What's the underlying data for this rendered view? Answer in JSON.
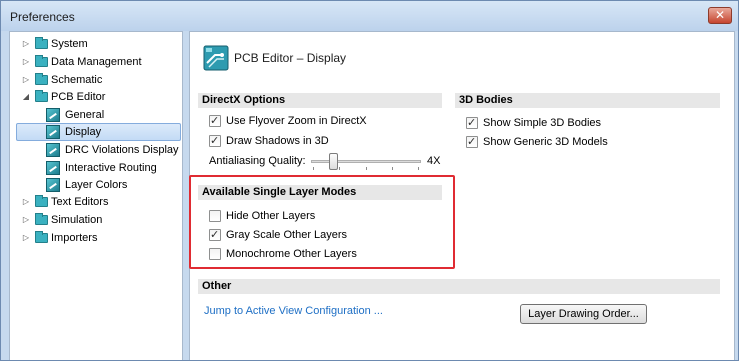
{
  "window": {
    "title": "Preferences",
    "close_symbol": "✕"
  },
  "tree": {
    "items": [
      {
        "label": "System",
        "expander": "▷",
        "icon": "folder-icon"
      },
      {
        "label": "Data Management",
        "expander": "▷",
        "icon": "folder-icon"
      },
      {
        "label": "Schematic",
        "expander": "▷",
        "icon": "folder-icon"
      },
      {
        "label": "PCB Editor",
        "expander": "◢",
        "icon": "folder-icon"
      },
      {
        "label": "General",
        "icon": "pcb-page-icon"
      },
      {
        "label": "Display",
        "icon": "pcb-page-icon",
        "selected": true
      },
      {
        "label": "DRC Violations Display",
        "icon": "pcb-page-icon"
      },
      {
        "label": "Interactive Routing",
        "icon": "pcb-page-icon"
      },
      {
        "label": "Layer Colors",
        "icon": "pcb-page-icon"
      },
      {
        "label": "Text Editors",
        "expander": "▷",
        "icon": "folder-icon"
      },
      {
        "label": "Simulation",
        "expander": "▷",
        "icon": "folder-icon"
      },
      {
        "label": "Importers",
        "expander": "▷",
        "icon": "folder-icon"
      }
    ]
  },
  "page": {
    "title": "PCB Editor – Display",
    "directx": {
      "header": "DirectX Options",
      "options": [
        {
          "label": "Use Flyover Zoom in DirectX",
          "checked": true
        },
        {
          "label": "Draw Shadows in 3D",
          "checked": true
        }
      ],
      "antialiasing": {
        "label": "Antialiasing Quality:",
        "value_text": "4X",
        "level": 0.18
      }
    },
    "bodies3d": {
      "header": "3D Bodies",
      "options": [
        {
          "label": "Show Simple 3D Bodies",
          "checked": true
        },
        {
          "label": "Show Generic 3D Models",
          "checked": true
        }
      ]
    },
    "single_layer": {
      "header": "Available Single Layer Modes",
      "options": [
        {
          "label": "Hide Other Layers",
          "checked": false
        },
        {
          "label": "Gray Scale Other Layers",
          "checked": true
        },
        {
          "label": "Monochrome Other Layers",
          "checked": false
        }
      ]
    },
    "other": {
      "header": "Other",
      "link": "Jump to Active View Configuration ...",
      "button": "Layer Drawing Order..."
    }
  },
  "colors": {
    "highlight": "#e02b32",
    "link": "#1e6fc5",
    "accent": "#3ab1c0"
  }
}
